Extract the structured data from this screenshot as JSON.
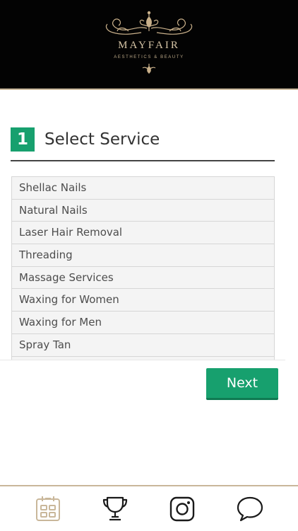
{
  "brand": {
    "name": "MAYFAIR",
    "tagline": "AESTHETICS & BEAUTY",
    "background": "#030303",
    "gold": "#c9b79a"
  },
  "step": {
    "number": "1",
    "title": "Select Service",
    "accent": "#17a06e"
  },
  "services": [
    "Shellac Nails",
    "Natural Nails",
    "Laser Hair Removal",
    "Threading",
    "Massage Services",
    "Waxing for Women",
    "Waxing for Men",
    "Spray Tan",
    ""
  ],
  "actions": {
    "next_label": "Next"
  },
  "bottom_nav": [
    {
      "icon": "calendar-icon",
      "active": true
    },
    {
      "icon": "trophy-icon",
      "active": false
    },
    {
      "icon": "instagram-icon",
      "active": false
    },
    {
      "icon": "chat-bubble-icon",
      "active": false
    }
  ]
}
